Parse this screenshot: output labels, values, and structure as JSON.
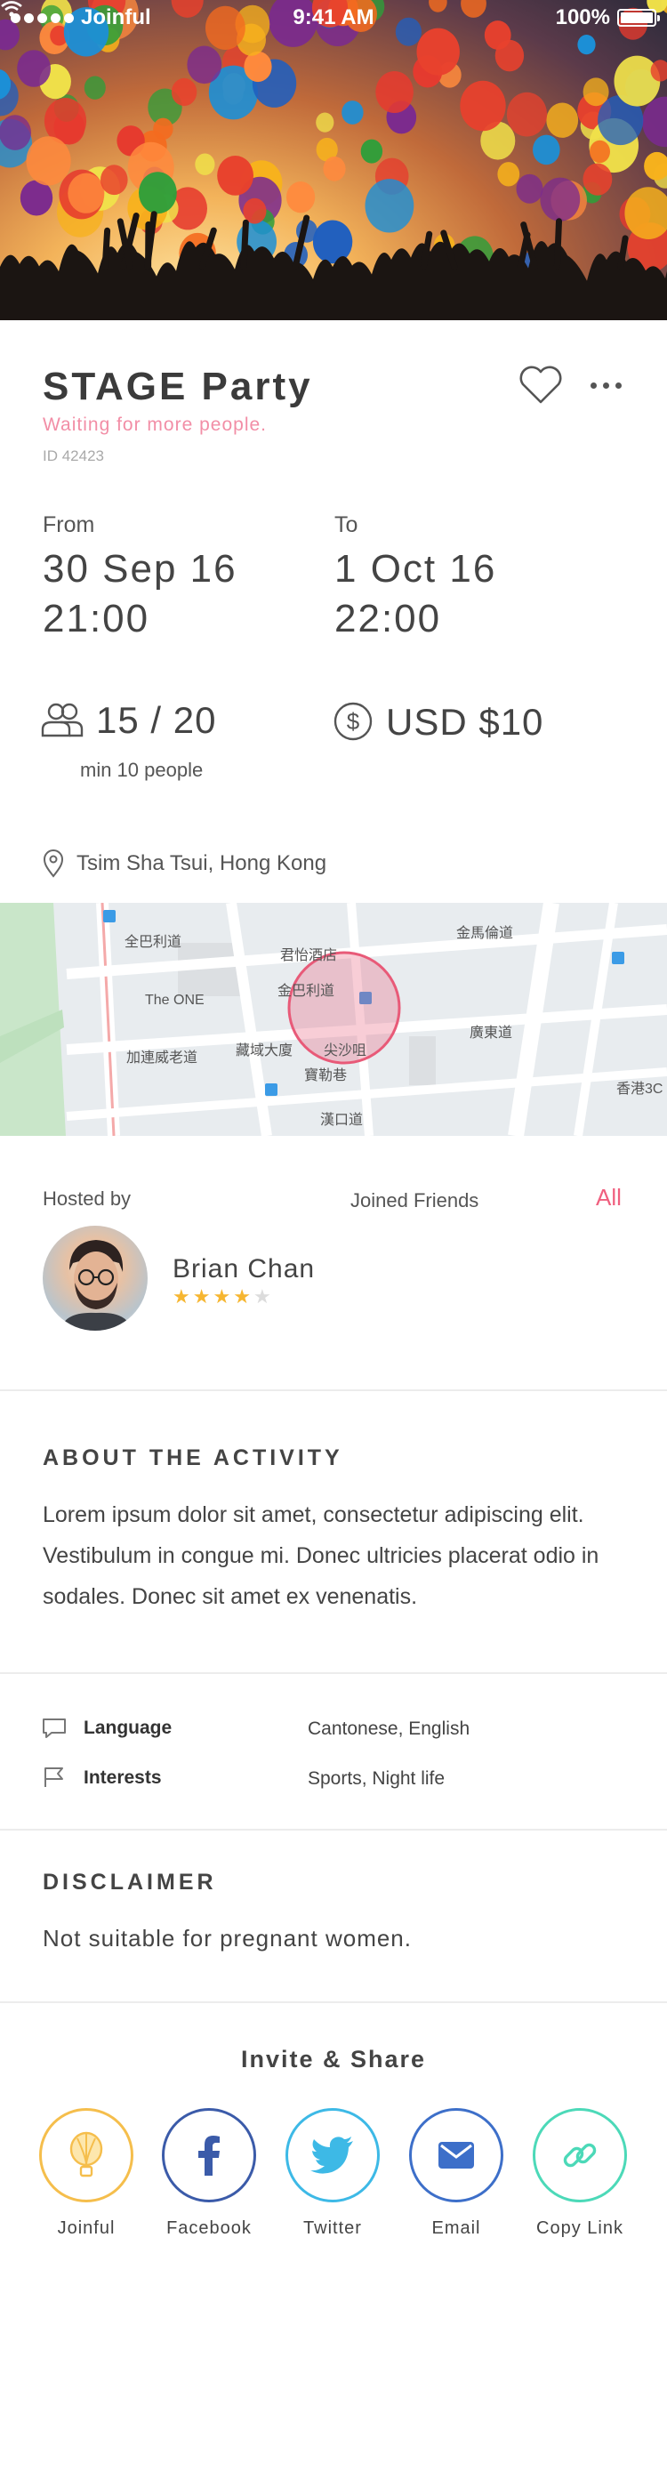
{
  "status_bar": {
    "carrier": "Joinful",
    "time": "9:41 AM",
    "battery": "100%"
  },
  "event": {
    "title": "STAGE Party",
    "subtitle": "Waiting for more people.",
    "id_label": "ID 42423"
  },
  "dates": {
    "from_label": "From",
    "from_date": "30 Sep 16",
    "from_time": "21:00",
    "to_label": "To",
    "to_date": "1 Oct 16",
    "to_time": "22:00"
  },
  "stats": {
    "people": "15 / 20",
    "min_people": "min 10 people",
    "price": "USD $10"
  },
  "location": {
    "text": "Tsim Sha Tsui, Hong Kong"
  },
  "map": {
    "labels": [
      "全巴利道",
      "君怡酒店",
      "金巴利道",
      "The ONE",
      "加連威老道",
      "藏域大廈",
      "尖沙咀",
      "廣東道",
      "寶勒巷",
      "金馬倫道",
      "漢口道",
      "香港3C"
    ],
    "accent": "#e85a78"
  },
  "host": {
    "hosted_label": "Hosted by",
    "joined_label": "Joined Friends",
    "all_link": "All",
    "name": "Brian Chan",
    "rating": 4,
    "rating_max": 5
  },
  "about": {
    "heading": "ABOUT THE ACTIVITY",
    "body": "Lorem ipsum dolor sit amet, consectetur adipiscing elit. Vestibulum in congue mi. Donec ultricies placerat odio in sodales. Donec sit amet ex venenatis."
  },
  "info": {
    "language_label": "Language",
    "language_value": "Cantonese, English",
    "interests_label": "Interests",
    "interests_value": "Sports, Night life"
  },
  "disclaimer": {
    "heading": "DISCLAIMER",
    "body": "Not suitable for pregnant women."
  },
  "share": {
    "title": "Invite & Share",
    "items": [
      {
        "label": "Joinful",
        "icon": "balloon-icon",
        "color": "#f5be4c"
      },
      {
        "label": "Facebook",
        "icon": "facebook-icon",
        "color": "#3b5ba9"
      },
      {
        "label": "Twitter",
        "icon": "twitter-icon",
        "color": "#3db9e6"
      },
      {
        "label": "Email",
        "icon": "email-icon",
        "color": "#3d6fc9"
      },
      {
        "label": "Copy Link",
        "icon": "link-icon",
        "color": "#4cd9b8"
      }
    ]
  }
}
